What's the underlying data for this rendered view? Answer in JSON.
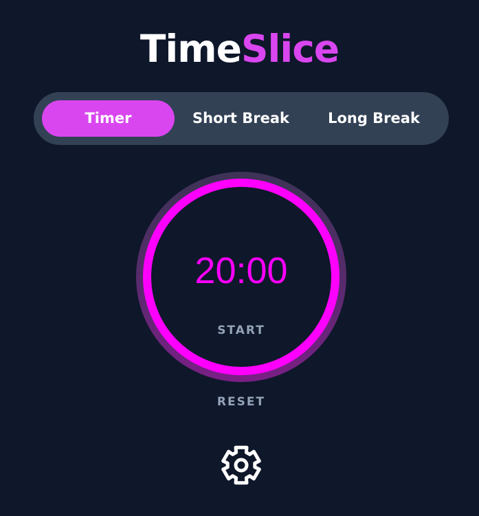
{
  "app": {
    "title_part1": "Time",
    "title_part2": "Slice"
  },
  "modes": [
    {
      "label": "Timer",
      "active": true
    },
    {
      "label": "Short Break",
      "active": false
    },
    {
      "label": "Long Break",
      "active": false
    }
  ],
  "timer": {
    "display": "20:00",
    "start_label": "START",
    "progress": 1.0
  },
  "controls": {
    "reset_label": "RESET",
    "settings_icon": "gear-icon"
  },
  "colors": {
    "background": "#0f172a",
    "accent": "#d946ef",
    "ring": "#ff00ff",
    "pill": "#334155",
    "muted_text": "#94a3b8"
  }
}
